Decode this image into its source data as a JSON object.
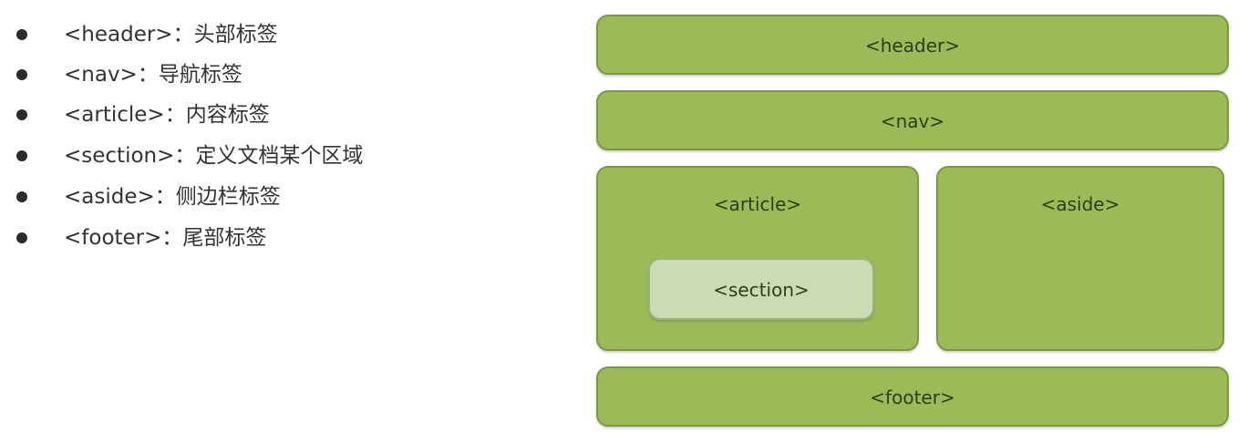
{
  "tags": [
    {
      "text": "<header>：头部标签"
    },
    {
      "text": "<nav>：导航标签"
    },
    {
      "text": "<article>：内容标签"
    },
    {
      "text": "<section>：定义文档某个区域"
    },
    {
      "text": "<aside>：侧边栏标签"
    },
    {
      "text": "<footer>：尾部标签"
    }
  ],
  "diagram": {
    "header": "<header>",
    "nav": "<nav>",
    "article": "<article>",
    "section": "<section>",
    "aside": "<aside>",
    "footer": "<footer>"
  },
  "colors": {
    "box_fill": "#9bbb59",
    "section_fill": "#cbdcb4",
    "text": "#333333"
  }
}
